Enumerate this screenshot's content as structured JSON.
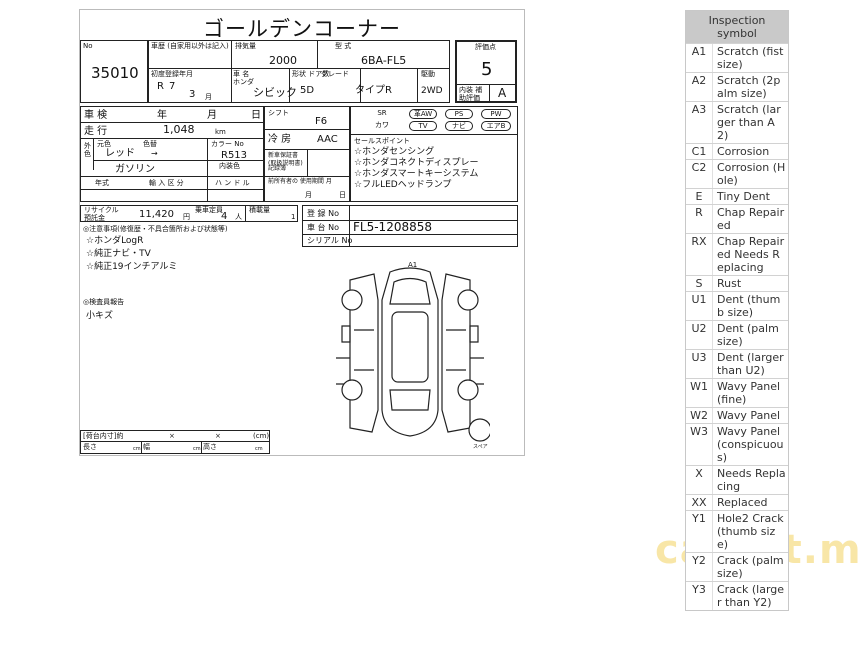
{
  "sheet": {
    "title": "ゴールデンコーナー",
    "lot": {
      "label": "No",
      "value": "35010"
    },
    "model_label": "車歴 (自家用以外は記入)",
    "displacement": {
      "label": "排気量",
      "value": "2000"
    },
    "model_code": {
      "label": "型 式",
      "value": "6BA-FL5"
    },
    "first_reg": {
      "label": "初度登録年月",
      "era": "R",
      "year": "7",
      "month": "3",
      "month_unit": "月"
    },
    "maker": {
      "label": "車 名",
      "maker": "ホンダ",
      "name": "シビック"
    },
    "doors": {
      "label": "形状 ドア数",
      "value": "5D"
    },
    "grade": {
      "label": "グレード",
      "value": "タイプR"
    },
    "drive": {
      "label": "駆動",
      "value": "2WD"
    },
    "score": {
      "label": "評価点",
      "value": "5",
      "interior_label": "内装 補助評価",
      "interior": "A"
    },
    "inspection": {
      "label": "車 検",
      "year": "年",
      "month": "月",
      "day": "日"
    },
    "mileage": {
      "label": "走 行",
      "value": "1,048",
      "unit": "km"
    },
    "shift": {
      "label": "シフト",
      "value": "F6"
    },
    "ac": {
      "label": "冷 房",
      "value": "AAC"
    },
    "color": {
      "label": "外 色",
      "original": "元色",
      "original_value": "レッド",
      "label2": "色替",
      "arrow": "→",
      "code_label": "カラー No",
      "code": "R513",
      "inner_label": "内装色"
    },
    "fuel": {
      "label": "燃料",
      "value": "ガソリン"
    },
    "import_label": "年式",
    "import_row": "輸 入 区 分",
    "handle": "ハ ン ド ル",
    "warranty": {
      "label": "新車保証書 (取扱説明書)",
      "record": "記録簿"
    },
    "previous": {
      "label": "前所有者の 使用期間 月",
      "month": "月",
      "day": "日"
    },
    "options_top": [
      "SR",
      "革AW",
      "PS",
      "PW"
    ],
    "options_bottom": [
      "カワ",
      "TV",
      "ナビ",
      "エアB"
    ],
    "sales_points": {
      "label": "セールスポイント",
      "items": [
        "☆ホンダセンシング",
        "☆ホンダコネクトディスプレー",
        "☆ホンダスマートキーシステム",
        "☆フルLEDヘッドランプ"
      ]
    },
    "recycle": {
      "label": "リサイクル 預託金",
      "value": "11,420",
      "unit": "円",
      "capacity_label": "乗車定員",
      "capacity": "4",
      "capacity_unit": "人",
      "load_label": "積載量",
      "load": "1"
    },
    "registration": {
      "label": "登 録 No"
    },
    "chassis": {
      "label": "車 台 No",
      "value": "FL5-1208858"
    },
    "serial": {
      "label": "シリアル No"
    },
    "notes": {
      "label": "◎注意事項(修復歴・不具合箇所および状態等)",
      "items": [
        "☆ホンダLogR",
        "☆純正ナビ・TV",
        "☆純正19インチアルミ"
      ]
    },
    "inspector": {
      "label": "◎検査員報告",
      "value": "小キズ"
    },
    "cargo": {
      "label": "[荷台内寸]約",
      "x1": "×",
      "x2": "×",
      "cm": "(cm)",
      "length": "長さ",
      "width": "幅",
      "height": "高さ",
      "unit": "cm"
    },
    "diagram_mark": "A1",
    "spare_label": "スペア"
  },
  "legend": {
    "title": "Inspection symbol",
    "rows": [
      {
        "code": "A1",
        "desc": "Scratch (fist size)"
      },
      {
        "code": "A2",
        "desc": "Scratch (2palm size)"
      },
      {
        "code": "A3",
        "desc": "Scratch (larger than A2)"
      },
      {
        "code": "C1",
        "desc": "Corrosion"
      },
      {
        "code": "C2",
        "desc": "Corrosion (Hole)"
      },
      {
        "code": "E",
        "desc": "Tiny Dent"
      },
      {
        "code": "R",
        "desc": "Chap Repaired"
      },
      {
        "code": "RX",
        "desc": "Chap Repaired Needs Replacing"
      },
      {
        "code": "S",
        "desc": "Rust"
      },
      {
        "code": "U1",
        "desc": "Dent (thumb size)"
      },
      {
        "code": "U2",
        "desc": "Dent (palm size)"
      },
      {
        "code": "U3",
        "desc": "Dent (larger than U2)"
      },
      {
        "code": "W1",
        "desc": "Wavy Panel (fine)"
      },
      {
        "code": "W2",
        "desc": "Wavy Panel"
      },
      {
        "code": "W3",
        "desc": "Wavy Panel (conspicuous)"
      },
      {
        "code": "X",
        "desc": "Needs Replacing"
      },
      {
        "code": "XX",
        "desc": "Replaced"
      },
      {
        "code": "Y1",
        "desc": "Hole2 Crack (thumb size)"
      },
      {
        "code": "Y2",
        "desc": "Crack (palm size)"
      },
      {
        "code": "Y3",
        "desc": "Crack (larger than Y2)"
      }
    ]
  },
  "watermark": "carlist.my"
}
